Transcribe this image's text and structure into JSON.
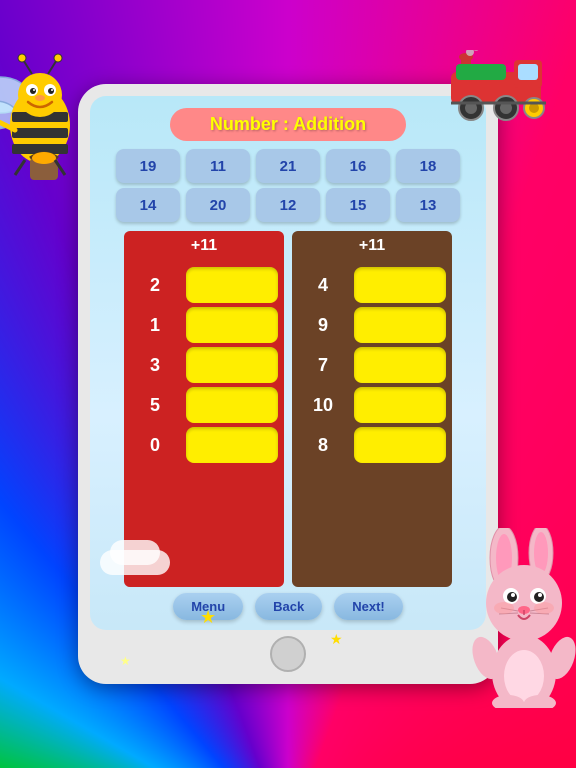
{
  "app": {
    "title": "Number : Addition"
  },
  "colors": {
    "rainbow_accent": "#ff8888",
    "title_text": "#ffff00",
    "num_btn_bg": "#a8c8e8",
    "table_red": "#cc2222",
    "table_brown": "#6b4226",
    "answer_box": "#ffee00",
    "bottom_btn_bg": "#aad0f0"
  },
  "number_rows": {
    "row1": [
      "19",
      "11",
      "21",
      "16",
      "18"
    ],
    "row2": [
      "14",
      "20",
      "12",
      "15",
      "13"
    ]
  },
  "left_table": {
    "header": "+11",
    "numbers": [
      "2",
      "1",
      "3",
      "5",
      "0"
    ]
  },
  "right_table": {
    "header": "+11",
    "numbers": [
      "4",
      "9",
      "7",
      "10",
      "8"
    ]
  },
  "buttons": {
    "menu": "Menu",
    "back": "Back",
    "next": "Next!"
  }
}
